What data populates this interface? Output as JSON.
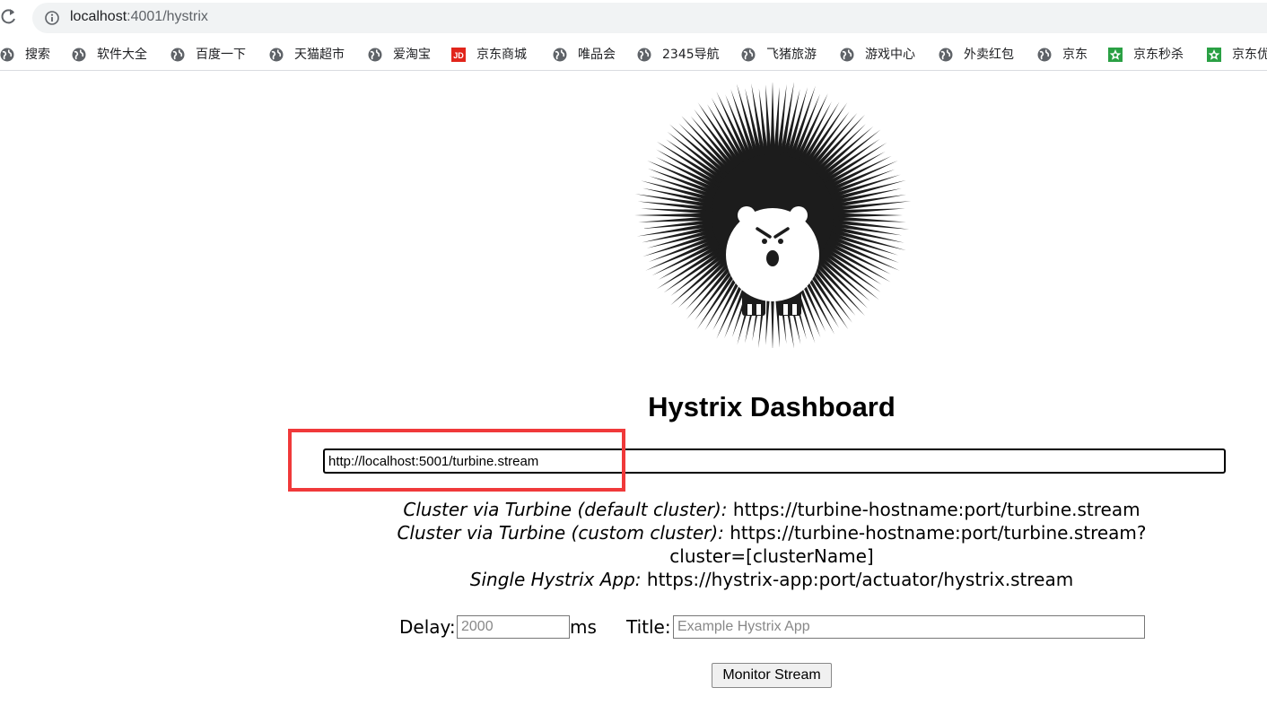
{
  "browser": {
    "url_host": "localhost",
    "url_path": ":4001/hystrix",
    "bookmarks": [
      {
        "label": "搜索",
        "icon": "globe-icon"
      },
      {
        "label": "软件大全",
        "icon": "globe-icon"
      },
      {
        "label": "百度一下",
        "icon": "globe-icon"
      },
      {
        "label": "天猫超市",
        "icon": "globe-icon"
      },
      {
        "label": "爱淘宝",
        "icon": "globe-icon"
      },
      {
        "label": "京东商城",
        "icon": "jd-icon",
        "icon_text": "JD"
      },
      {
        "label": "唯品会",
        "icon": "globe-icon"
      },
      {
        "label": "2345导航",
        "icon": "globe-icon"
      },
      {
        "label": "飞猪旅游",
        "icon": "globe-icon"
      },
      {
        "label": "游戏中心",
        "icon": "globe-icon"
      },
      {
        "label": "外卖红包",
        "icon": "globe-icon"
      },
      {
        "label": "京东",
        "icon": "globe-icon"
      },
      {
        "label": "京东秒杀",
        "icon": "green-star-icon"
      },
      {
        "label": "京东优",
        "icon": "green-star-icon"
      }
    ]
  },
  "dashboard": {
    "title": "Hystrix Dashboard",
    "stream_url": "http://localhost:5001/turbine.stream",
    "examples": [
      {
        "label": "Cluster via Turbine (default cluster):",
        "value": "https://turbine-hostname:port/turbine.stream"
      },
      {
        "label": "Cluster via Turbine (custom cluster):",
        "value": "https://turbine-hostname:port/turbine.stream?cluster=[clusterName]"
      },
      {
        "label": "Single Hystrix App:",
        "value": "https://hystrix-app:port/actuator/hystrix.stream"
      }
    ],
    "delay_label": "Delay:",
    "delay_placeholder": "2000",
    "delay_unit": "ms",
    "title_label": "Title:",
    "title_placeholder": "Example Hystrix App",
    "monitor_button": "Monitor Stream"
  },
  "colors": {
    "highlight": "#f0393a",
    "jd_red": "#e1251b",
    "star_green": "#2aa044"
  }
}
